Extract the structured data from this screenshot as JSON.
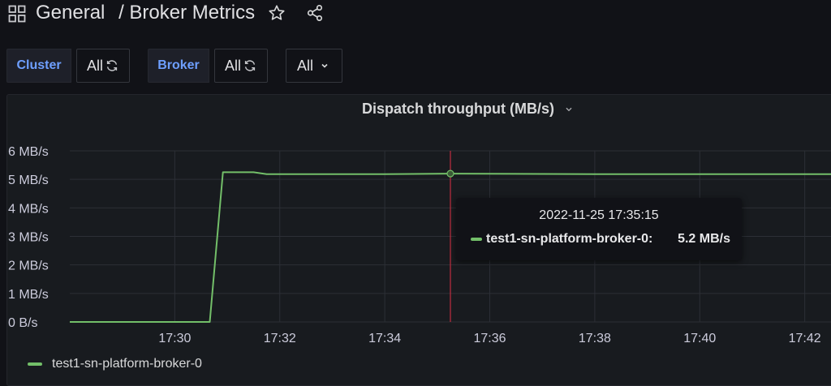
{
  "header": {
    "folder": "General",
    "separator": "/",
    "dashboard": "Broker Metrics"
  },
  "variables": [
    {
      "label": "Cluster",
      "value": "All"
    },
    {
      "label": "Broker",
      "value": "All"
    },
    {
      "label": "",
      "value": "All"
    }
  ],
  "panel": {
    "title": "Dispatch throughput (MB/s)"
  },
  "colors": {
    "series": "#73bf69",
    "cursor": "#e02f44",
    "accent": "#6e9fff"
  },
  "icons": [
    "apps-icon",
    "star-icon",
    "share-icon",
    "refresh-icon",
    "chevron-down-icon"
  ],
  "tooltip": {
    "time": "2022-11-25 17:35:15",
    "series": "test1-sn-platform-broker-0:",
    "value": "5.2 MB/s"
  },
  "chart_data": {
    "type": "line",
    "title": "Dispatch throughput (MB/s)",
    "y_ticks": [
      "0 B/s",
      "1 MB/s",
      "2 MB/s",
      "3 MB/s",
      "4 MB/s",
      "5 MB/s",
      "6 MB/s"
    ],
    "x_ticks": [
      "17:30",
      "17:32",
      "17:34",
      "17:36",
      "17:38",
      "17:40",
      "17:42"
    ],
    "ylim": [
      0,
      6
    ],
    "xlim": [
      "17:28:00",
      "17:42:30"
    ],
    "x_tick_values": [
      "17:30:00",
      "17:32:00",
      "17:34:00",
      "17:36:00",
      "17:38:00",
      "17:40:00",
      "17:42:00"
    ],
    "grid": true,
    "legend_position": "bottom-left",
    "cursor_time": "17:35:15",
    "series": [
      {
        "name": "test1-sn-platform-broker-0",
        "x": [
          "17:28:00",
          "17:30:40",
          "17:30:55",
          "17:31:30",
          "17:31:45",
          "17:32:30",
          "17:34:00",
          "17:35:15",
          "17:38:00",
          "17:40:00",
          "17:42:30"
        ],
        "values": [
          0,
          0,
          5.25,
          5.25,
          5.18,
          5.18,
          5.18,
          5.2,
          5.18,
          5.18,
          5.18
        ]
      }
    ],
    "legend": [
      "test1-sn-platform-broker-0"
    ]
  }
}
